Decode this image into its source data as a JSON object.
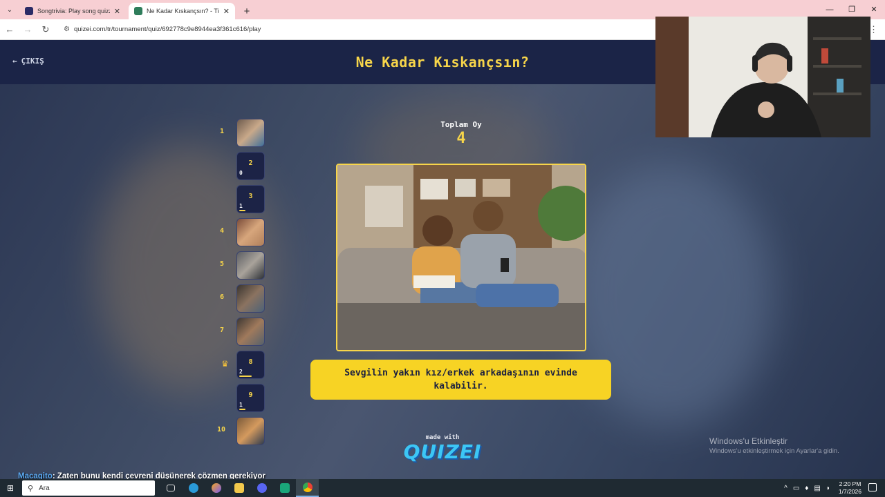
{
  "browser": {
    "tabs": [
      {
        "title": "Songtrivia: Play song quizzes w",
        "active": false,
        "favicon_color": "#2b2b66"
      },
      {
        "title": "Ne Kadar Kıskançsın? - Tier List",
        "active": true,
        "favicon_color": "#2f7d5b"
      }
    ],
    "url": "quizei.com/tr/tournament/quiz/692778c9e8944ea3f361c616/play"
  },
  "page": {
    "exit_label": "ÇIKIŞ",
    "title": "Ne Kadar Kıskançsın?",
    "total_label": "Toplam Oy",
    "total_value": "4",
    "answer_text": "Sevgilin yakın kız/erkek arkadaşının evinde kalabilir.",
    "made_with": "made with",
    "logo": "QUIZEI"
  },
  "ranks": [
    {
      "num": "1",
      "type": "image",
      "colors": [
        "#6d5b4e",
        "#c9a98a",
        "#3f6f9a"
      ]
    },
    {
      "num": "",
      "type": "slot",
      "slot": "2",
      "count": "0",
      "bar": 0
    },
    {
      "num": "",
      "type": "slot",
      "slot": "3",
      "count": "1",
      "bar": 0.25
    },
    {
      "num": "4",
      "type": "image",
      "colors": [
        "#7a4c3a",
        "#d7a67c",
        "#b07f5a"
      ]
    },
    {
      "num": "5",
      "type": "image",
      "colors": [
        "#5c5e63",
        "#a9a39b",
        "#2d3137"
      ]
    },
    {
      "num": "6",
      "type": "image",
      "colors": [
        "#3a3530",
        "#8b7360",
        "#4d6277"
      ]
    },
    {
      "num": "7",
      "type": "image",
      "colors": [
        "#3e3833",
        "#a07a5c",
        "#55606b"
      ]
    },
    {
      "num": "",
      "type": "slot",
      "slot": "8",
      "count": "2",
      "bar": 0.5,
      "crown": true
    },
    {
      "num": "",
      "type": "slot",
      "slot": "9",
      "count": "1",
      "bar": 0.25
    },
    {
      "num": "10",
      "type": "image",
      "colors": [
        "#7a5a3a",
        "#d49a5e",
        "#2f3b4e"
      ]
    }
  ],
  "windows": {
    "activate_title": "Windows'u Etkinleştir",
    "activate_sub": "Windows'u etkinleştirmek için Ayarlar'a gidin."
  },
  "chat": {
    "user": "Macagito",
    "message": ": Zaten bunu kendi çevreni düşünerek çözmen gerekiyor"
  },
  "taskbar": {
    "search_placeholder": "Ara",
    "time": "2:20 PM",
    "date": "1/7/2026"
  }
}
